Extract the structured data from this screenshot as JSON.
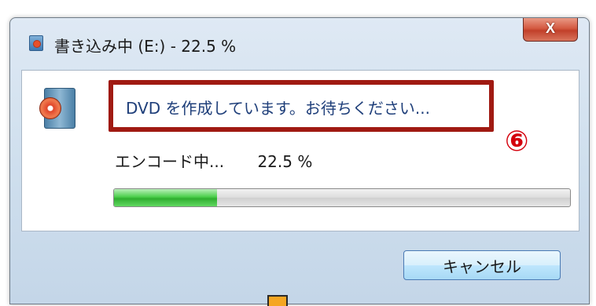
{
  "window": {
    "title": "書き込み中 (E:) - 22.5 %",
    "close_label": "X"
  },
  "dialog": {
    "status_message": "DVD を作成しています。お待ちください...",
    "annotation_marker": "⑥",
    "encoding_label": "エンコード中...",
    "progress_percent_text": "22.5 %",
    "progress_value": 0.225,
    "cancel_label": "キャンセル"
  },
  "colors": {
    "highlight_box": "#a01a12",
    "annotation_marker": "#d4000c",
    "progress_fill": "#3fbf3f",
    "status_text": "#1f3f7a"
  },
  "icons": [
    "dvd-burner-icon",
    "close-icon",
    "disc-icon"
  ]
}
